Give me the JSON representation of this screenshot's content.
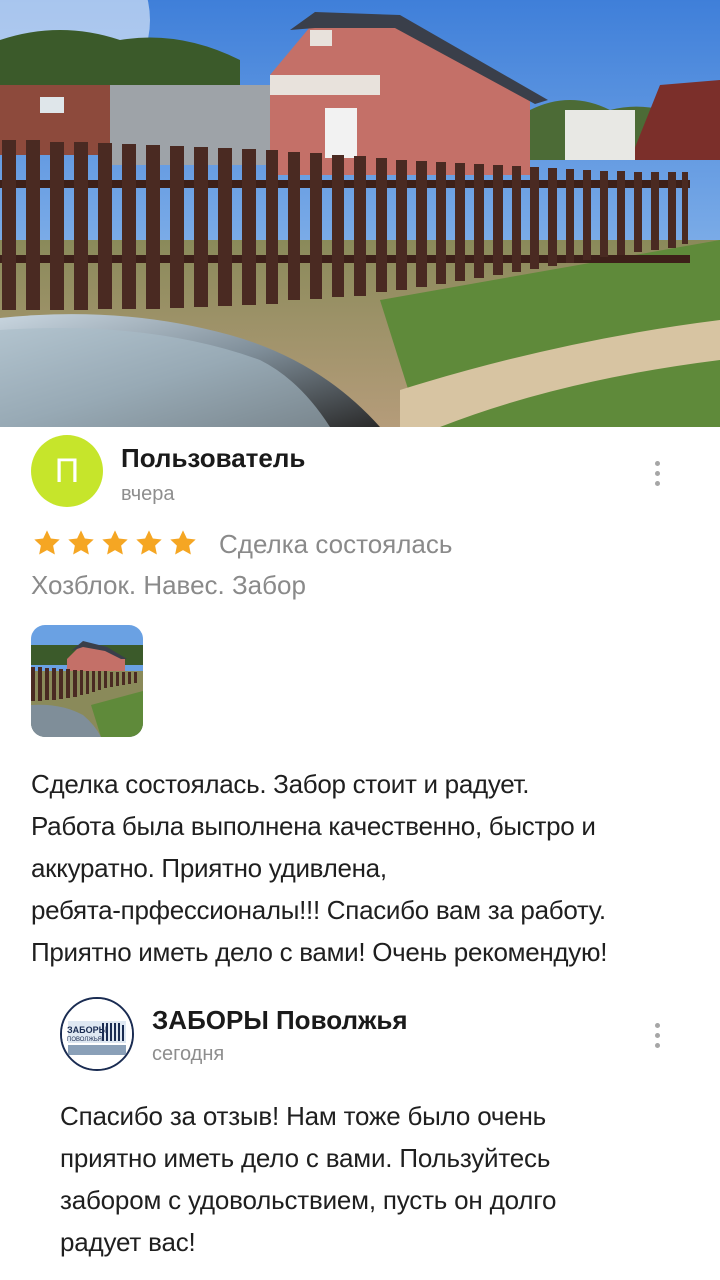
{
  "review": {
    "avatar_letter": "П",
    "author": "Пользователь",
    "date": "вчера",
    "rating": 5,
    "deal_status": "Сделка состоялась",
    "title": "Хозблок. Навес. Забор",
    "text": "Сделка состоялась. Забор стоит и радует.\nРабота была выполнена качественно, быстро и\nаккуратно. Приятно удивлена,\nребята-прфессионалы!!! Спасибо вам за работу.\nПриятно иметь дело с вами! Очень рекомендую!"
  },
  "reply": {
    "author": "ЗАБОРЫ Поволжья",
    "date": "сегодня",
    "logo_text": "ЗАБОРЫ ПОВОЛЖЬЯ",
    "text": "Спасибо за отзыв! Нам тоже было очень\nприятно иметь дело с вами. Пользуйтесь\nзабором с удовольствием, пусть он долго\nрадует вас!"
  },
  "colors": {
    "avatar": "#c6e52b",
    "star": "#f5a623",
    "muted_text": "#8a8a8a",
    "fence": "#4a2a22",
    "house": "#c47068"
  },
  "icons": [
    "more-vertical-icon",
    "star-icon"
  ]
}
